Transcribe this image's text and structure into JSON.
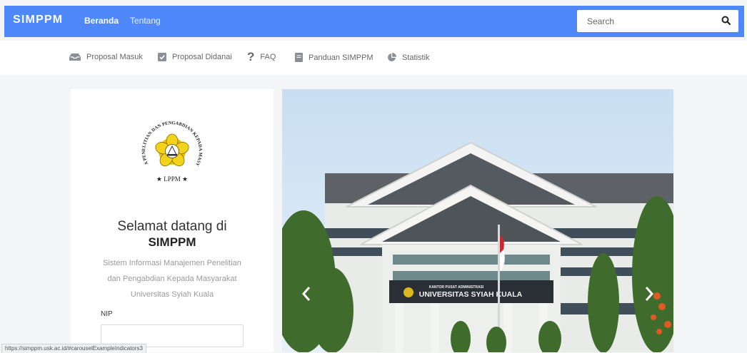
{
  "header": {
    "brand": "SIMPPM",
    "nav": {
      "home": "Beranda",
      "about": "Tentang"
    },
    "search": {
      "placeholder": "Search",
      "value": ""
    }
  },
  "subnav": {
    "items": [
      {
        "label": "Proposal Masuk",
        "icon": "inbox-icon"
      },
      {
        "label": "Proposal Didanai",
        "icon": "check-square-icon"
      },
      {
        "label": "FAQ",
        "icon": "question-icon"
      },
      {
        "label": "Panduan SIMPPM",
        "icon": "book-icon"
      },
      {
        "label": "Statistik",
        "icon": "pie-chart-icon"
      }
    ]
  },
  "login": {
    "logo_text": {
      "ring": "LEMBAGA PENELITIAN DAN PENGABDIAN KEPADA MASYARAKAT",
      "bottom": "LPPM"
    },
    "welcome": "Selamat datang di",
    "app_name": "SIMPPM",
    "desc_line1": "Sistem Informasi Manajemen Penelitian",
    "desc_line2": "dan Pengabdian Kepada Masyarakat",
    "desc_line3": "Universitas Syiah Kuala",
    "nip_label": "NIP",
    "nip_value": ""
  },
  "carousel": {
    "sign_small": "KANTOR PUSAT ADMINISTRASI",
    "sign_main": "UNIVERSITAS SYIAH KUALA"
  },
  "status_url": "https://simppm.usk.ac.id/#carouselExampleIndicators3",
  "colors": {
    "accent": "#4e88fb",
    "page_bg": "#f4f5f7"
  }
}
